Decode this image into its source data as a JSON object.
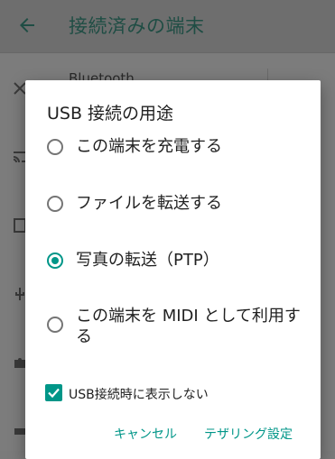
{
  "background_app": {
    "title": "接続済みの端末",
    "list_item_label": "Bluetooth"
  },
  "dialog": {
    "title": "USB 接続の用途",
    "options": [
      {
        "label": "この端末を充電する",
        "selected": false
      },
      {
        "label": "ファイルを転送する",
        "selected": false
      },
      {
        "label": "写真の転送（PTP）",
        "selected": true
      },
      {
        "label": "この端末を MIDI として利用する",
        "selected": false
      }
    ],
    "checkbox": {
      "label": "USB接続時に表示しない",
      "checked": true
    },
    "buttons": {
      "cancel": "キャンセル",
      "tethering": "テザリング設定"
    }
  },
  "colors": {
    "accent": "#009688",
    "scrim": "#7b7b7b",
    "dialog": "#ffffff"
  }
}
